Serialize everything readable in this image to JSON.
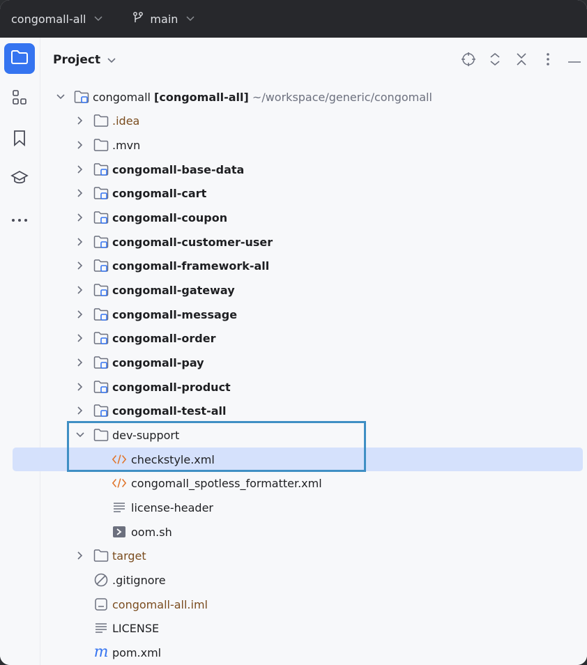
{
  "titlebar": {
    "project_name": "congomall-all",
    "branch_name": "main"
  },
  "toolstrip": {
    "items": [
      "folder-icon",
      "structure-icon",
      "bookmark-icon",
      "learn-icon",
      "more-icon"
    ]
  },
  "panel": {
    "title": "Project",
    "actions": [
      "locate-icon",
      "expand-collapse-icon",
      "collapse-all-icon",
      "options-icon",
      "hide-icon"
    ]
  },
  "tree": {
    "root": {
      "name": "congomall",
      "module": "[congomall-all]",
      "path": "~/workspace/generic/congomall"
    },
    "idea": ".idea",
    "mvn": ".mvn",
    "modules": [
      "congomall-base-data",
      "congomall-cart",
      "congomall-coupon",
      "congomall-customer-user",
      "congomall-framework-all",
      "congomall-gateway",
      "congomall-message",
      "congomall-order",
      "congomall-pay",
      "congomall-product",
      "congomall-test-all"
    ],
    "dev_support": {
      "name": "dev-support",
      "children": [
        "checkstyle.xml",
        "congomall_spotless_formatter.xml",
        "license-header",
        "oom.sh"
      ]
    },
    "target": "target",
    "gitignore": ".gitignore",
    "iml": "congomall-all.iml",
    "license": "LICENSE",
    "pom": "pom.xml"
  },
  "colors": {
    "accent": "#3574f0",
    "selection": "#d5e1fc",
    "highlight_box": "#3f8fc4",
    "excluded_text": "#7a4c1e",
    "xml_icon": "#e0742a"
  }
}
